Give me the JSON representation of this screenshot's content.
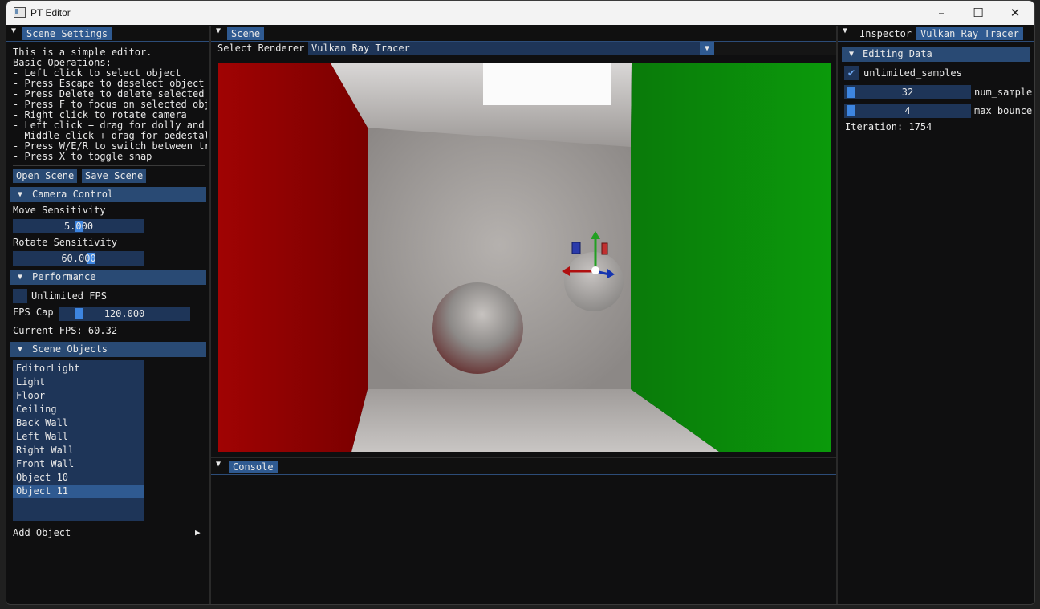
{
  "window": {
    "title": "PT Editor",
    "minimize": "–",
    "maximize": "☐",
    "close": "✕"
  },
  "left_panel": {
    "tab": "Scene Settings",
    "help_lines": [
      "This is a simple editor.",
      "Basic Operations:",
      "- Left click to select object",
      "- Press Escape to deselect object",
      "- Press Delete to delete selected c",
      "- Press F to focus on selected obje",
      "- Right click to rotate camera",
      "- Left click + drag for dolly and t",
      "- Middle click + drag for pedestal",
      "- Press W/E/R to switch between tra",
      "- Press X to toggle snap"
    ],
    "open_scene": "Open Scene",
    "save_scene": "Save Scene",
    "camera_control": {
      "header": "Camera Control",
      "move_label": "Move Sensitivity",
      "move_value": "5.000",
      "move_fraction": 0.5,
      "rotate_label": "Rotate Sensitivity",
      "rotate_value": "60.000",
      "rotate_fraction": 0.6
    },
    "performance": {
      "header": "Performance",
      "unlimited_fps": "Unlimited FPS",
      "unlimited_checked": false,
      "fps_cap_label": "FPS Cap",
      "fps_cap_value": "120.000",
      "fps_cap_fraction": 0.12,
      "current_fps": "Current FPS: 60.32"
    },
    "scene_objects": {
      "header": "Scene Objects",
      "items": [
        "EditorLight",
        "Light",
        "Floor",
        "Ceiling",
        "Back Wall",
        "Left Wall",
        "Right Wall",
        "Front Wall",
        "Object 10",
        "Object 11"
      ],
      "selected": "Object 11",
      "add_object": "Add Object"
    }
  },
  "scene_panel": {
    "tab": "Scene",
    "select_renderer_label": "Select Renderer",
    "renderer": "Vulkan Ray Tracer"
  },
  "console_panel": {
    "tab": "Console"
  },
  "right_panel": {
    "tabs": [
      "Inspector",
      "Vulkan Ray Tracer"
    ],
    "active_tab": "Vulkan Ray Tracer",
    "editing_header": "Editing Data",
    "unlimited_samples_label": "unlimited_samples",
    "unlimited_samples_checked": true,
    "num_samples_value": "32",
    "num_samples_label": "num_sample",
    "max_bounce_value": "4",
    "max_bounce_label": "max_bounce",
    "iteration": "Iteration: 1754"
  },
  "colors": {
    "accent": "#294a74",
    "active": "#2f5a91",
    "grab": "#3d85e0",
    "frame": "#1e3558",
    "wall_red": "#8e0000",
    "wall_green": "#0f8a0f"
  }
}
